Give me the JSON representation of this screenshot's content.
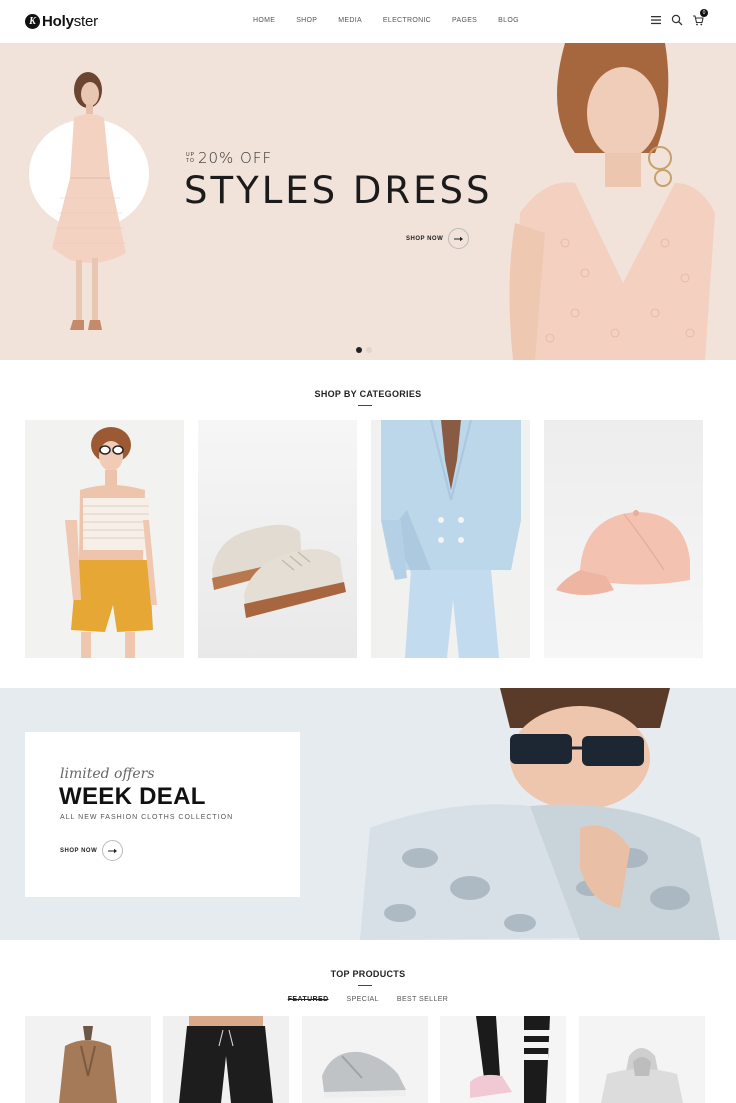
{
  "header": {
    "logo_mark": "K",
    "logo_bold": "Holy",
    "logo_rest": "ster",
    "nav": [
      "HOME",
      "SHOP",
      "MEDIA",
      "ELECTRONIC",
      "PAGES",
      "BLOG"
    ],
    "cart_count": "0",
    "icons": [
      "menu-icon",
      "search-icon",
      "cart-icon"
    ]
  },
  "hero": {
    "up": "UP",
    "to": "TO",
    "discount": "20% OFF",
    "title": "STYLES DRESS",
    "button_label": "SHOP NOW",
    "background": "#f1e2da",
    "slides": 2,
    "active_slide": 1
  },
  "categories": {
    "title": "SHOP BY CATEGORIES",
    "items": [
      "woman-crop-top-image",
      "sneakers-image",
      "blue-suit-image",
      "pink-cap-image"
    ]
  },
  "deal": {
    "script": "limited offers",
    "title": "WEEK DEAL",
    "subtitle": "ALL NEW FASHION CLOTHS COLLECTION",
    "button_label": "SHOP NOW",
    "background": "#e5ebee"
  },
  "products": {
    "title": "TOP PRODUCTS",
    "tabs": [
      "FEATURED",
      "SPECIAL",
      "BEST SELLER"
    ],
    "active_tab": "FEATURED",
    "items": [
      "fur-coat-image",
      "black-joggers-image",
      "grey-sneakers-image",
      "leggings-sneakers-image",
      "grey-hoodie-image"
    ]
  }
}
